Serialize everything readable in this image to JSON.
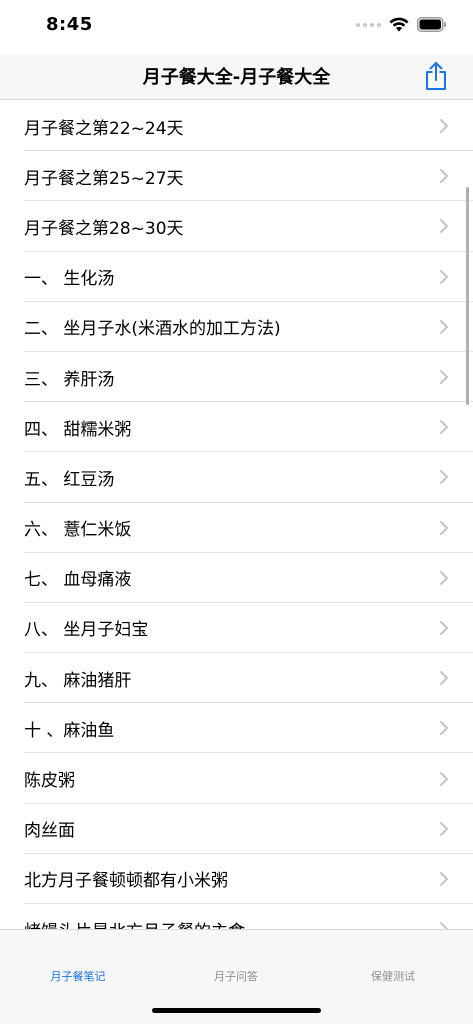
{
  "status_bar": {
    "time": "8:45"
  },
  "nav": {
    "title": "月子餐大全-月子餐大全",
    "share_icon": "share-icon"
  },
  "list": {
    "items": [
      "月子餐之第22~24天",
      "月子餐之第25~27天",
      "月子餐之第28~30天",
      "一、 生化汤",
      "二、 坐月子水(米酒水的加工方法)",
      "三、 养肝汤",
      "四、 甜糯米粥",
      "五、 红豆汤",
      "六、 薏仁米饭",
      "七、 血母痛液",
      "八、 坐月子妇宝",
      "九、 麻油猪肝",
      "十 、麻油鱼",
      "陈皮粥",
      "肉丝面",
      "北方月子餐顿顿都有小米粥",
      "烤馒头片是北方月子餐的主食"
    ]
  },
  "tabs": [
    {
      "label": "月子餐笔记",
      "active": true
    },
    {
      "label": "月子问答",
      "active": false
    },
    {
      "label": "保健测试",
      "active": false
    }
  ],
  "colors": {
    "accent": "#1a73e8",
    "inactive_tab": "#8e8e93",
    "chevron": "#c4c4c7"
  }
}
